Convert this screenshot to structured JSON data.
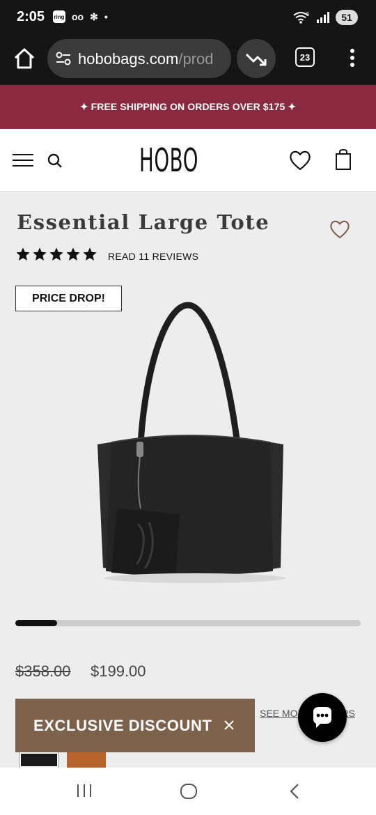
{
  "status_bar": {
    "time": "2:05",
    "ring_badge": "ring",
    "voicemail_glyph": "ᴏᴏ",
    "slack_glyph": "✻",
    "dot": "•",
    "wifi_label": "5",
    "battery": "51"
  },
  "browser": {
    "url_main": "hobobags.com",
    "url_dim": "/prod",
    "tab_count": "23"
  },
  "promo": {
    "text": "✦ FREE SHIPPING ON ORDERS OVER $175 ✦"
  },
  "header": {
    "logo": "HOBO"
  },
  "product": {
    "title": "Essential Large Tote",
    "rating": 5,
    "reviews_label": "READ 11 REVIEWS",
    "badge": "PRICE DROP!",
    "gallery_progress": 0.12,
    "price_original": "$358.00",
    "price_sale": "$199.00",
    "see_more_label": "SEE MORE COLORS",
    "swatches": [
      {
        "name": "black",
        "color": "#1a1a1a"
      },
      {
        "name": "brown",
        "color": "#b5652d"
      }
    ]
  },
  "discount_banner": {
    "text": "EXCLUSIVE DISCOUNT",
    "close_glyph": "×"
  },
  "colors": {
    "promo_bg": "#8b2940",
    "discount_bg": "#7c614b"
  },
  "icons": {
    "home": "home-icon",
    "site_settings": "tune-icon",
    "trending": "trending-down-icon",
    "overflow": "more-vert-icon",
    "menu": "hamburger-icon",
    "search": "search-icon",
    "wishlist": "heart-icon",
    "cart": "shopping-bag-icon",
    "chat": "chat-icon"
  }
}
